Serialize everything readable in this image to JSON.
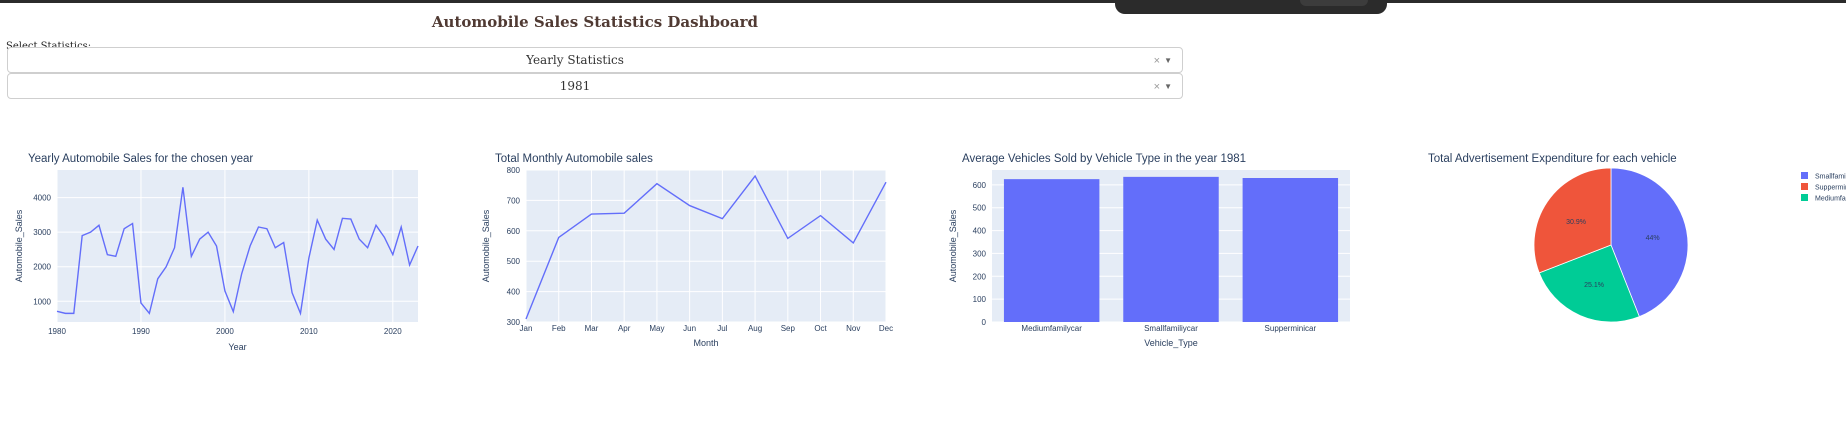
{
  "header": {
    "title": "Automobile Sales Statistics Dashboard"
  },
  "controls": {
    "label": "Select Statistics:",
    "statistics_value": "Yearly Statistics",
    "year_value": "1981",
    "clear_glyph": "×",
    "arrow_glyph": "▼"
  },
  "colors": {
    "plot_bg": "#e5ecf6",
    "line": "#636efa",
    "grid": "#ffffff",
    "text": "#2a3f5f",
    "title": "#503a33"
  },
  "chart_data": [
    {
      "type": "line",
      "title": "Yearly Automobile Sales for the chosen year",
      "xlabel": "Year",
      "ylabel": "Automobile_Sales",
      "xlim": [
        1980,
        2023
      ],
      "ylim": [
        400,
        4800
      ],
      "xticks": [
        1980,
        1990,
        2000,
        2010,
        2020
      ],
      "xtick_labels": [
        "1980",
        "1990",
        "2000",
        "2010",
        "2020"
      ],
      "yticks": [
        1000,
        2000,
        3000,
        4000
      ],
      "ytick_labels": [
        "1000",
        "2000",
        "3000",
        "4000"
      ],
      "x": [
        1980,
        1981,
        1982,
        1983,
        1984,
        1985,
        1986,
        1987,
        1988,
        1989,
        1990,
        1991,
        1992,
        1993,
        1994,
        1995,
        1996,
        1997,
        1998,
        1999,
        2000,
        2001,
        2002,
        2003,
        2004,
        2005,
        2006,
        2007,
        2008,
        2009,
        2010,
        2011,
        2012,
        2013,
        2014,
        2015,
        2016,
        2017,
        2018,
        2019,
        2020,
        2021,
        2022,
        2023
      ],
      "y": [
        710,
        650,
        650,
        2900,
        3000,
        3200,
        2350,
        2300,
        3100,
        3250,
        950,
        650,
        1650,
        2000,
        2550,
        4300,
        2300,
        2800,
        3000,
        2600,
        1300,
        700,
        1800,
        2600,
        3150,
        3100,
        2550,
        2700,
        1250,
        650,
        2250,
        3350,
        2800,
        2500,
        3400,
        3380,
        2800,
        2550,
        3200,
        2850,
        2350,
        3150,
        2050,
        2600
      ],
      "grid": true
    },
    {
      "type": "line",
      "title": "Total Monthly Automobile sales",
      "xlabel": "Month",
      "ylabel": "Automobile_Sales",
      "ylim": [
        300,
        800
      ],
      "categories": [
        "Jan",
        "Feb",
        "Mar",
        "Apr",
        "May",
        "Jun",
        "Jul",
        "Aug",
        "Sep",
        "Oct",
        "Nov",
        "Dec"
      ],
      "values": [
        310,
        578,
        655,
        658,
        755,
        683,
        640,
        780,
        575,
        650,
        560,
        760
      ],
      "yticks": [
        300,
        400,
        500,
        600,
        700,
        800
      ],
      "ytick_labels": [
        "300",
        "400",
        "500",
        "600",
        "700",
        "800"
      ],
      "grid": true
    },
    {
      "type": "bar",
      "title": "Average Vehicles Sold by Vehicle Type in the year 1981",
      "xlabel": "Vehicle_Type",
      "ylabel": "Automobile_Sales",
      "ylim": [
        0,
        665
      ],
      "categories": [
        "Mediumfamilycar",
        "Smallfamiliycar",
        "Supperminicar"
      ],
      "values": [
        625,
        635,
        630
      ],
      "yticks": [
        0,
        100,
        200,
        300,
        400,
        500,
        600
      ],
      "ytick_labels": [
        "0",
        "100",
        "200",
        "300",
        "400",
        "500",
        "600"
      ],
      "grid": true
    },
    {
      "type": "pie",
      "title": "Total Advertisement Expenditure for each vehicle",
      "slices": [
        {
          "name": "Smallfamiliycar",
          "legend_label": "Smallfamilyc",
          "value": 44,
          "label": "44%",
          "color": "#636efa"
        },
        {
          "name": "Mediumfamilycar",
          "legend_label": "Mediumfamil",
          "value": 25.1,
          "label": "25.1%",
          "color": "#00cc96"
        },
        {
          "name": "Supperminicar",
          "legend_label": "Supperminica",
          "value": 30.9,
          "label": "30.9%",
          "color": "#ef553b"
        }
      ],
      "legend_order": [
        "Smallfamiliycar",
        "Supperminicar",
        "Mediumfamilycar"
      ],
      "legend_position": "top-right"
    }
  ]
}
